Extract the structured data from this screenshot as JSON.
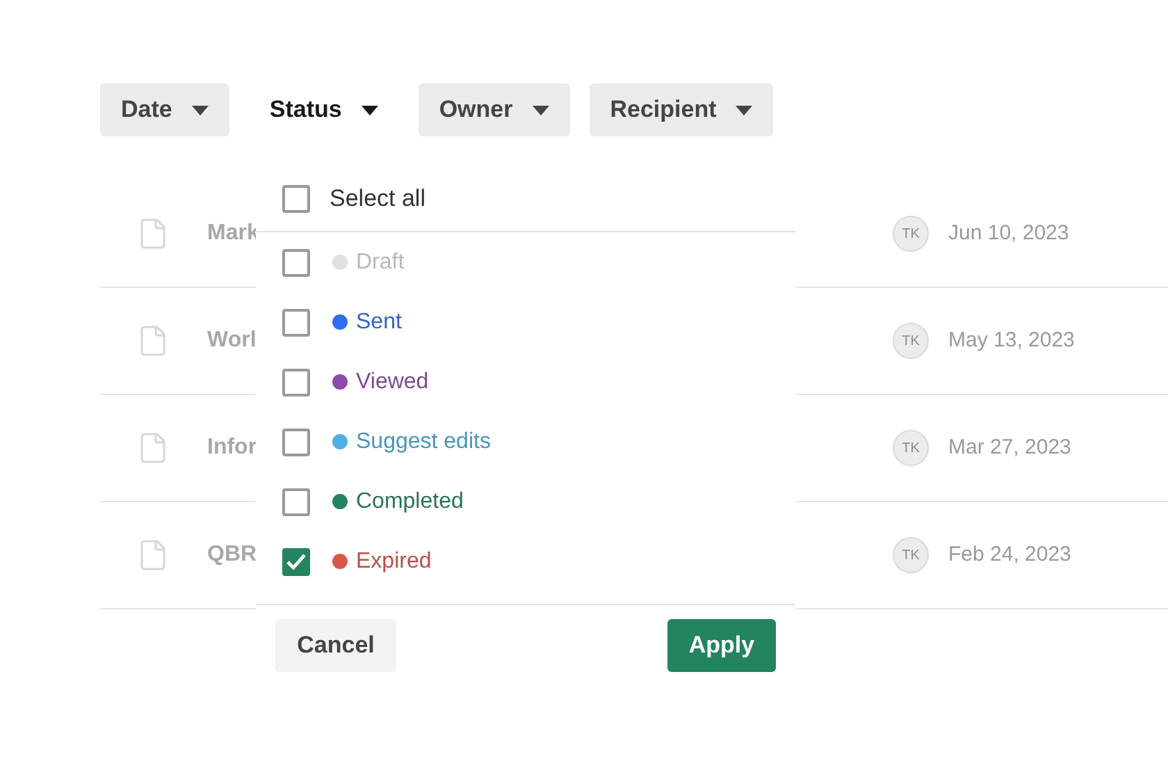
{
  "filters": [
    {
      "label": "Date",
      "selected": false
    },
    {
      "label": "Status",
      "selected": true
    },
    {
      "label": "Owner",
      "selected": false
    },
    {
      "label": "Recipient",
      "selected": false
    }
  ],
  "documents": [
    {
      "name": "Mark",
      "avatar": "TK",
      "date": "Jun 10, 2023"
    },
    {
      "name": "Worl",
      "avatar": "TK",
      "date": "May 13, 2023"
    },
    {
      "name": "Infor",
      "avatar": "TK",
      "date": "Mar 27, 2023"
    },
    {
      "name": "QBR",
      "avatar": "TK",
      "date": "Feb 24, 2023"
    }
  ],
  "status_menu": {
    "select_all": {
      "label": "Select all",
      "checked": false
    },
    "options": [
      {
        "label": "Draft",
        "color": "#e0e0e0",
        "checked": false
      },
      {
        "label": "Sent",
        "color": "#2f6df0",
        "checked": false
      },
      {
        "label": "Viewed",
        "color": "#8e4aa8",
        "checked": false
      },
      {
        "label": "Suggest edits",
        "color": "#4fb0e0",
        "checked": false
      },
      {
        "label": "Completed",
        "color": "#23845f",
        "checked": false
      },
      {
        "label": "Expired",
        "color": "#d9574b",
        "checked": true
      }
    ],
    "cancel": "Cancel",
    "apply": "Apply"
  }
}
